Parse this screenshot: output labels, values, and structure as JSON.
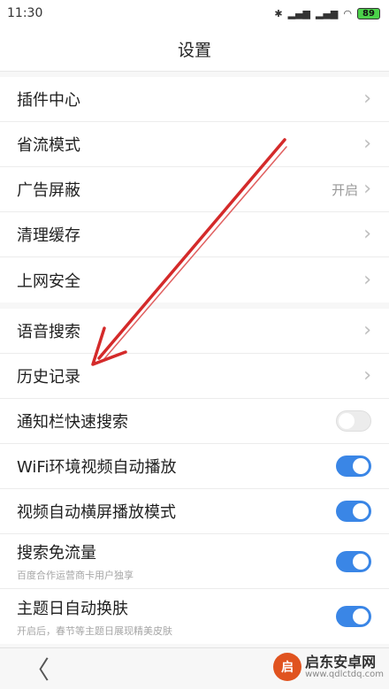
{
  "status": {
    "time": "11:30",
    "battery": "89",
    "icons": [
      "bluetooth-icon",
      "signal-icon",
      "signal-icon",
      "wifi-icon"
    ]
  },
  "title": "设置",
  "groups": [
    {
      "items": [
        {
          "label": "插件中心",
          "control": "chevron"
        },
        {
          "label": "省流模式",
          "control": "chevron"
        },
        {
          "label": "广告屏蔽",
          "value": "开启",
          "control": "chevron"
        },
        {
          "label": "清理缓存",
          "control": "chevron"
        },
        {
          "label": "上网安全",
          "control": "chevron"
        }
      ]
    },
    {
      "items": [
        {
          "label": "语音搜索",
          "control": "chevron"
        },
        {
          "label": "历史记录",
          "control": "chevron"
        },
        {
          "label": "通知栏快速搜索",
          "control": "toggle",
          "on": false
        },
        {
          "label": "WiFi环境视频自动播放",
          "control": "toggle",
          "on": true
        },
        {
          "label": "视频自动横屏播放模式",
          "control": "toggle",
          "on": true
        },
        {
          "label": "搜索免流量",
          "sub": "百度合作运营商卡用户独享",
          "control": "toggle",
          "on": true
        },
        {
          "label": "主题日自动换肤",
          "sub": "开启后，春节等主题日展现精美皮肤",
          "control": "toggle",
          "on": true
        }
      ]
    }
  ],
  "nav": {
    "back": "〈"
  },
  "watermark": {
    "logo": "启",
    "title": "启东安卓网",
    "url": "www.qdlctdq.com"
  },
  "colors": {
    "accent": "#3a86e6",
    "arrow": "#d42a2a"
  }
}
